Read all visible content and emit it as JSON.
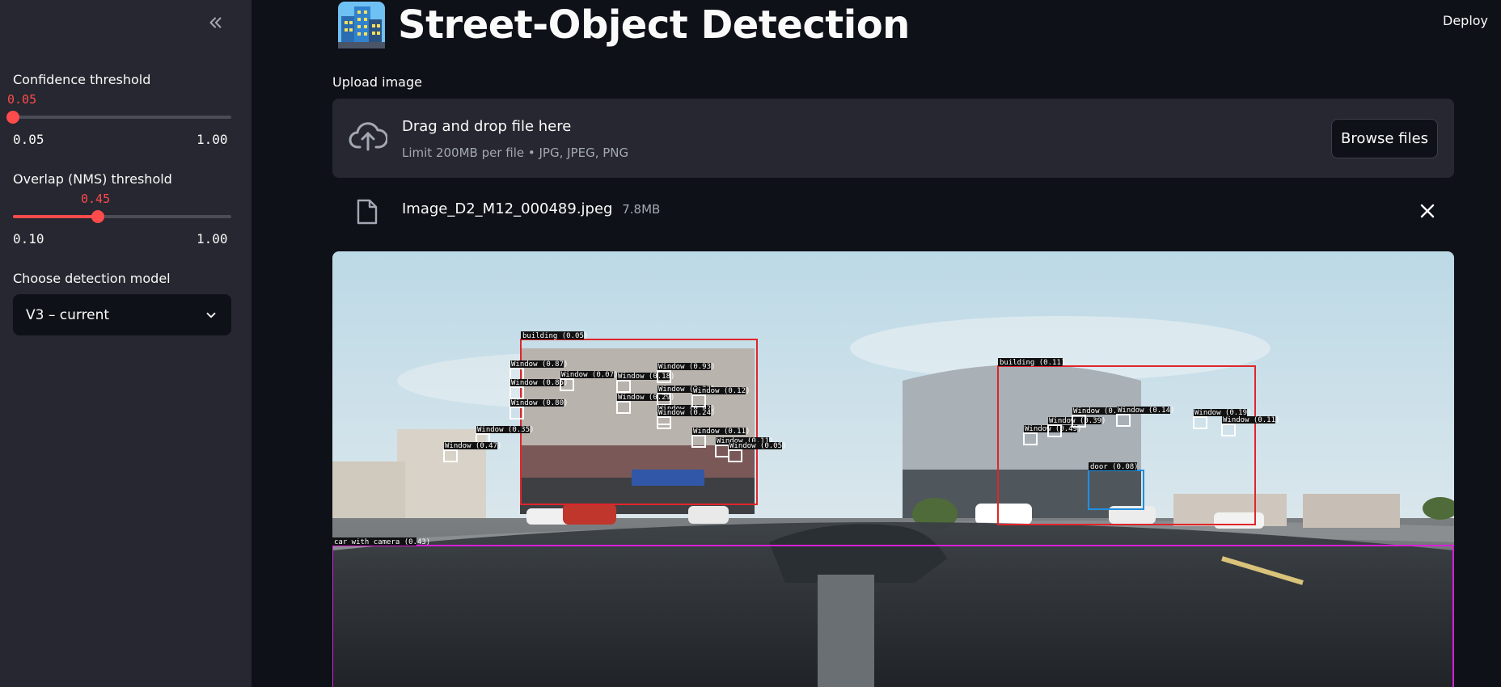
{
  "sidebar": {
    "collapse_icon": "double-chevron-left-icon",
    "confidence": {
      "label": "Confidence threshold",
      "value": "0.05",
      "min": "0.05",
      "max": "1.00",
      "fraction": 0.0
    },
    "nms": {
      "label": "Overlap (NMS) threshold",
      "value": "0.45",
      "min": "0.10",
      "max": "1.00",
      "fraction": 0.389
    },
    "model": {
      "label": "Choose detection model",
      "selected": "V3 – current"
    }
  },
  "header": {
    "deploy_label": "Deploy",
    "title": "Street-Object Detection",
    "title_icon": "city-buildings-emoji"
  },
  "upload": {
    "label": "Upload image",
    "drop_title": "Drag and drop file here",
    "drop_sub": "Limit 200MB per file • JPG, JPEG, PNG",
    "browse_label": "Browse files",
    "file": {
      "name": "Image_D2_M12_000489.jpeg",
      "size": "7.8MB"
    }
  },
  "detections": {
    "building_1": "building (0.05)",
    "building_2": "building (0.11)",
    "door_1": "door (0.08)",
    "car_camera": "car with camera (0.43)",
    "windows": [
      "Window (0.87)",
      "Window (0.85)",
      "Window (0.80)",
      "Window (0.07)",
      "Window (0.18)",
      "Window (0.29)",
      "Window (0.27)",
      "Window (0.93)",
      "Window (0.92)",
      "Window (0.12)",
      "Window (0.24)",
      "Window (0.11)",
      "Window (0.11)",
      "Window (0.05)",
      "Window (0.35)",
      "Window (0.47)",
      "Window (0.49)",
      "Window (0.39)",
      "Window (0.51)",
      "Window (0.14)",
      "Window (0.19)",
      "Window (0.11)"
    ]
  },
  "colors": {
    "accent": "#ff4b4b",
    "building_box": "#e0252b",
    "window_box": "#ffffff",
    "door_box": "#1f8fe0",
    "car_box": "#d81fd8"
  }
}
